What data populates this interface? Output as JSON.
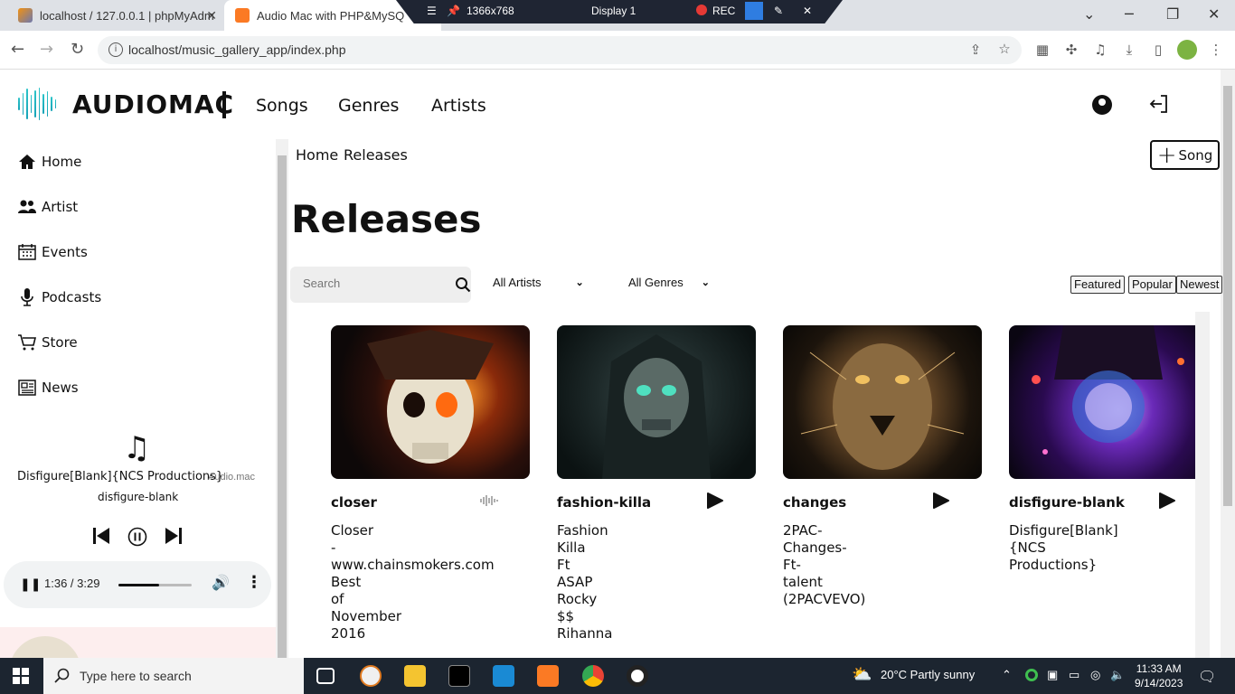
{
  "browser": {
    "tabs": [
      {
        "title": "localhost / 127.0.0.1 | phpMyAdm"
      },
      {
        "title": "Audio Mac with PHP&MySQ"
      }
    ],
    "url": "localhost/music_gallery_app/index.php"
  },
  "recorder": {
    "resolution": "1366x768",
    "display": "Display 1",
    "rec": "REC"
  },
  "header": {
    "logo": "AUDIOMAC",
    "nav": [
      "Songs",
      "Genres",
      "Artists"
    ]
  },
  "sidebar": {
    "items": [
      {
        "label": "Home",
        "icon": "home-icon"
      },
      {
        "label": "Artist",
        "icon": "users-icon"
      },
      {
        "label": "Events",
        "icon": "calendar-icon"
      },
      {
        "label": "Podcasts",
        "icon": "microphone-icon"
      },
      {
        "label": "Store",
        "icon": "cart-icon"
      },
      {
        "label": "News",
        "icon": "newspaper-icon"
      }
    ],
    "now_playing": {
      "title": "Disfigure[Blank]{NCS Productions}",
      "source": "Audio.mac",
      "slug": "disfigure-blank"
    },
    "audio": {
      "time": "1:36 / 3:29",
      "volume": 0.55
    }
  },
  "main": {
    "breadcrumb": [
      "Home",
      "Releases"
    ],
    "add_button": "Song",
    "title": "Releases",
    "search_placeholder": "Search",
    "artist_filter": "All Artists",
    "genre_filter": "All Genres",
    "sort_buttons": [
      "Featured",
      "Popular",
      "Newest"
    ],
    "cards": [
      {
        "name": "closer",
        "desc": [
          "Closer",
          "-",
          "www.chainsmokers.com",
          "Best",
          "of",
          "November",
          "2016"
        ],
        "playing": true
      },
      {
        "name": "fashion-killa",
        "desc": [
          "Fashion",
          "Killa",
          "Ft",
          "ASAP",
          "Rocky",
          "$$",
          "Rihanna"
        ],
        "playing": false
      },
      {
        "name": "changes",
        "desc": [
          "2PAC-",
          "Changes-",
          "Ft-",
          "talent",
          "(2PACVEVO)"
        ],
        "playing": false
      },
      {
        "name": "disfigure-blank",
        "desc": [
          "Disfigure[Blank]",
          "{NCS",
          "Productions}"
        ],
        "playing": false
      }
    ]
  },
  "taskbar": {
    "search_placeholder": "Type here to search",
    "weather": "20°C  Partly sunny",
    "time": "11:33 AM",
    "date": "9/14/2023",
    "notification_count": "1"
  }
}
